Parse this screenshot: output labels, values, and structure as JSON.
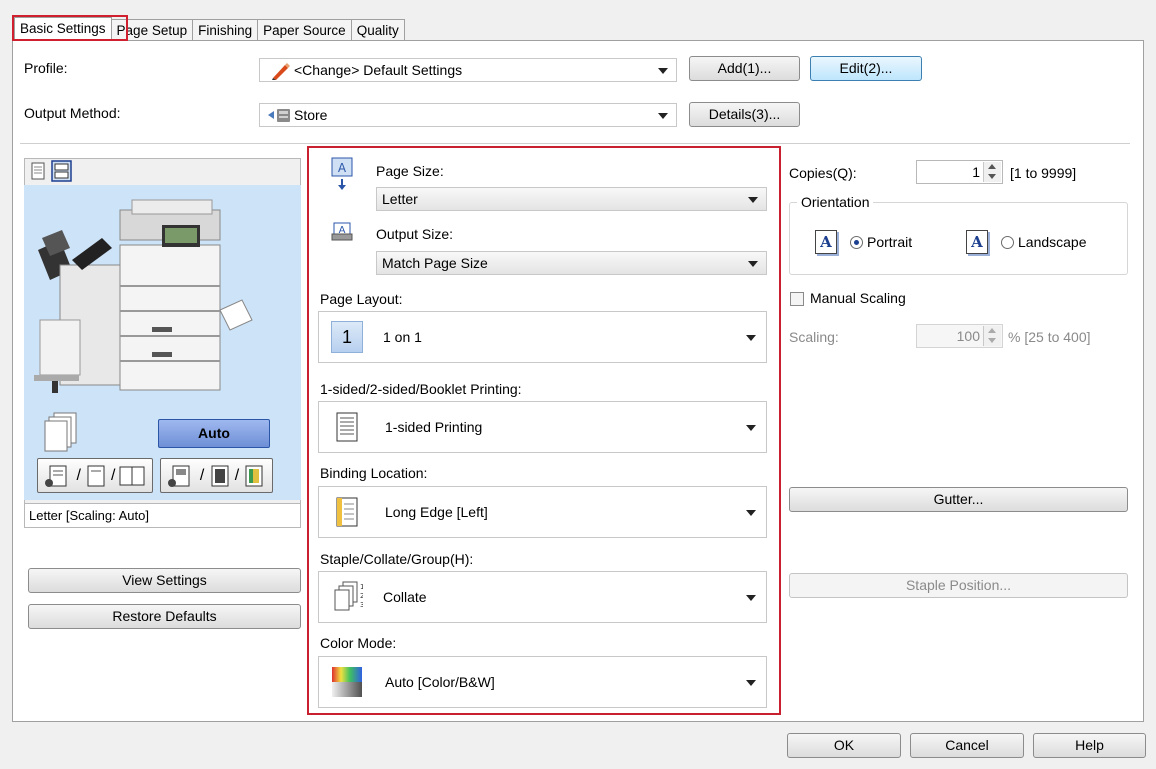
{
  "tabs": [
    {
      "label": "Basic Settings",
      "active": true
    },
    {
      "label": "Page Setup"
    },
    {
      "label": "Finishing"
    },
    {
      "label": "Paper Source"
    },
    {
      "label": "Quality"
    }
  ],
  "profile": {
    "label": "Profile:",
    "value": "<Change> Default Settings",
    "add_label": "Add(1)...",
    "edit_label": "Edit(2)...",
    "icon": "pencil-icon"
  },
  "output_method": {
    "label": "Output Method:",
    "value": "Store",
    "details_label": "Details(3)...",
    "icon": "store-icon"
  },
  "preview": {
    "auto_label": "Auto",
    "caption": "Letter [Scaling: Auto]",
    "view_settings_label": "View Settings",
    "restore_defaults_label": "Restore Defaults"
  },
  "page_size": {
    "label": "Page Size:",
    "value": "Letter"
  },
  "output_size": {
    "label": "Output Size:",
    "value": "Match Page Size"
  },
  "page_layout": {
    "label": "Page Layout:",
    "value": "1 on 1",
    "icon_text": "1"
  },
  "sided": {
    "label": "1-sided/2-sided/Booklet Printing:",
    "value": "1-sided Printing"
  },
  "binding": {
    "label": "Binding Location:",
    "value": "Long Edge [Left]"
  },
  "staple": {
    "label": "Staple/Collate/Group(H):",
    "value": "Collate"
  },
  "color_mode": {
    "label": "Color Mode:",
    "value": "Auto [Color/B&W]"
  },
  "copies": {
    "label": "Copies(Q):",
    "value": "1",
    "range": "[1 to 9999]"
  },
  "orientation": {
    "label": "Orientation",
    "portrait_label": "Portrait",
    "landscape_label": "Landscape",
    "selected": "Portrait"
  },
  "manual_scaling": {
    "label": "Manual Scaling",
    "checked": false
  },
  "scaling": {
    "label": "Scaling:",
    "value": "100",
    "range": "% [25 to 400]"
  },
  "gutter_label": "Gutter...",
  "staple_position_label": "Staple Position...",
  "footer": {
    "ok_label": "OK",
    "cancel_label": "Cancel",
    "help_label": "Help"
  },
  "colors": {
    "highlight": "#c8202e",
    "preview_bg": "#cde3f7",
    "auto_button": "#8aa6e6"
  }
}
